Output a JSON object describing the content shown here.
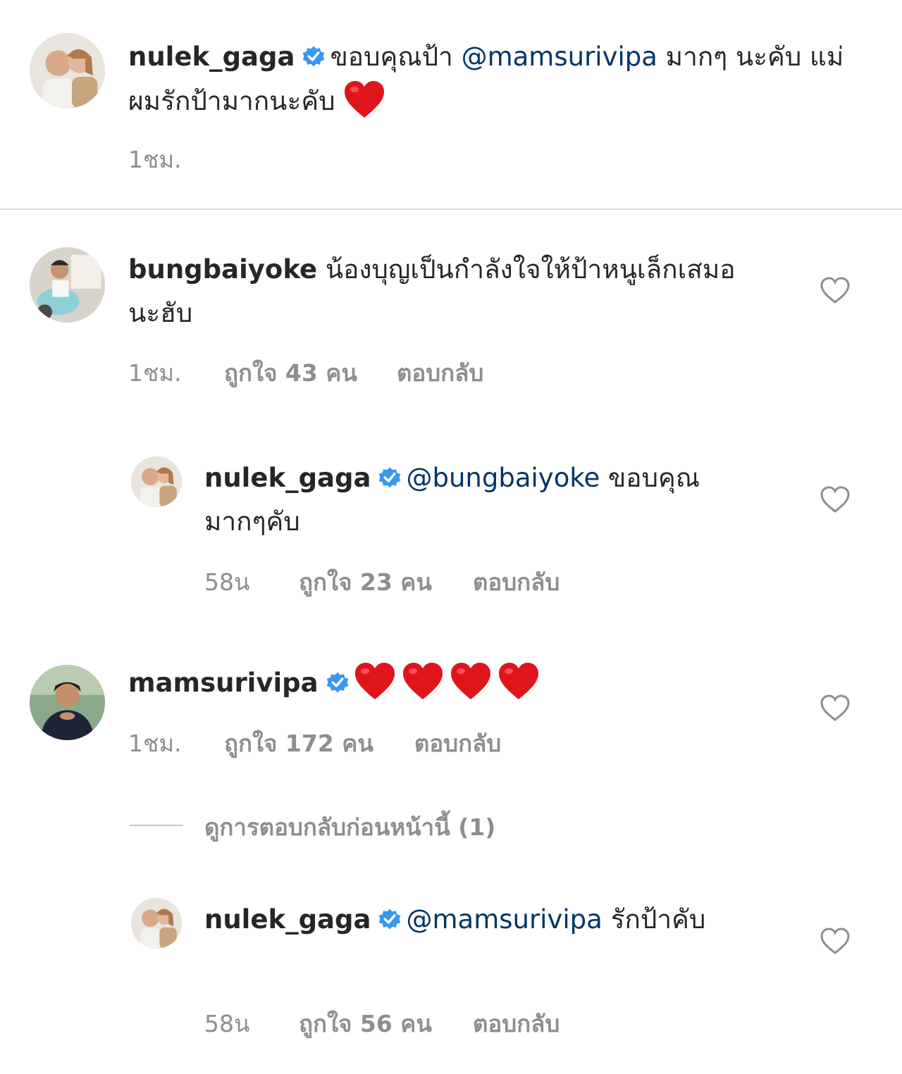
{
  "colors": {
    "accent_blue": "#3897f0",
    "mention": "#003569",
    "meta": "#8e8e8e",
    "heart_red": "#e0151c"
  },
  "caption": {
    "username": "nulek_gaga",
    "text_before": "ขอบคุณป้า ",
    "mention": "@mamsurivipa",
    "text_after": "  มากๆ นะคับ  แม่ผมรักป้ามากนะคับ ",
    "emoji": "heart-emoji",
    "time": "1ชม."
  },
  "comments": [
    {
      "username": "bungbaiyoke",
      "text": "น้องบุญเป็นกำลังใจให้ป้าหนูเล็กเสมอนะฮับ",
      "time": "1ชม.",
      "likes": "ถูกใจ 43 คน",
      "reply": "ตอบกลับ"
    },
    {
      "username": "nulek_gaga",
      "mention": "@bungbaiyoke",
      "text": " ขอบคุณมากๆคับ",
      "time": "58น",
      "likes": "ถูกใจ 23 คน",
      "reply": "ตอบกลับ"
    },
    {
      "username": "mamsurivipa",
      "emoji_count": 4,
      "time": "1ชม.",
      "likes": "ถูกใจ 172 คน",
      "reply": "ตอบกลับ"
    },
    {
      "username": "nulek_gaga",
      "mention": "@mamsurivipa",
      "text": " รักป้าคับ",
      "time": "58น",
      "likes": "ถูกใจ 56 คน",
      "reply": "ตอบกลับ"
    }
  ],
  "view_previous_replies": "ดูการตอบกลับก่อนหน้านี้ (1)"
}
